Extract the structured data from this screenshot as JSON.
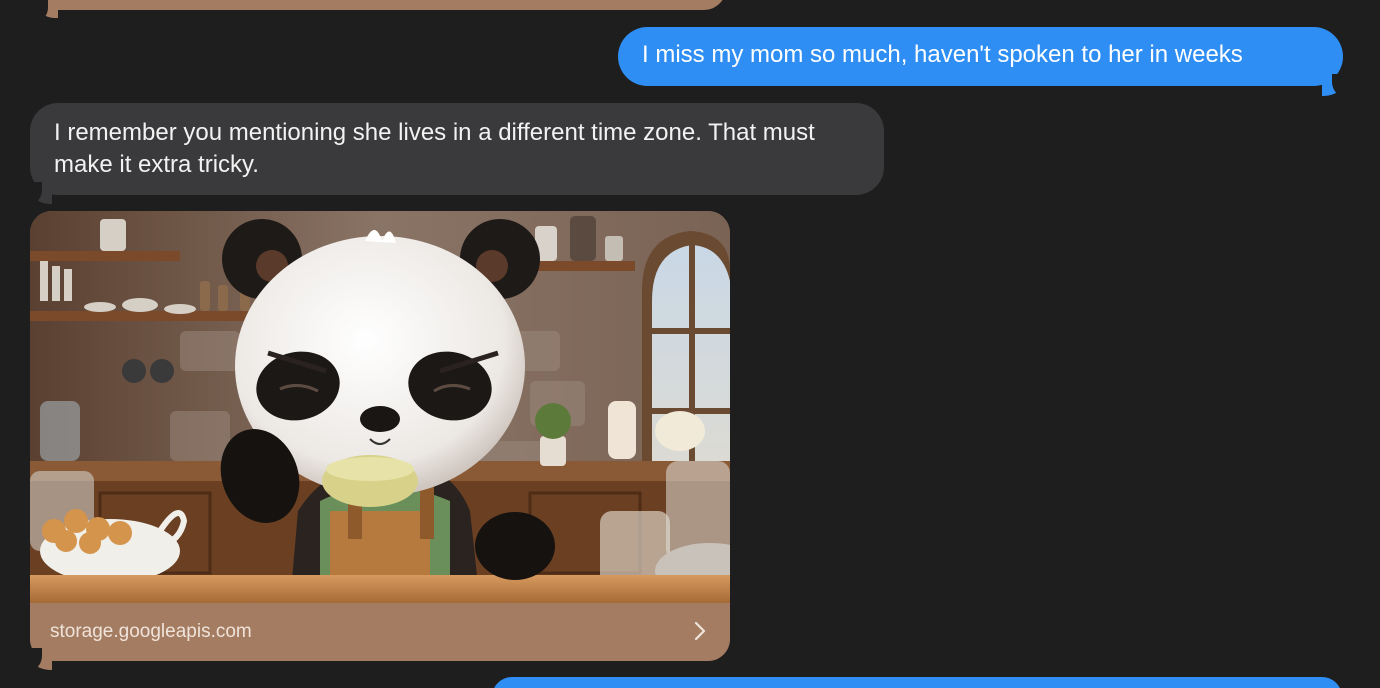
{
  "conversation": {
    "messages": [
      {
        "sender": "me",
        "text": "I miss my mom so much, haven't spoken to her in weeks"
      },
      {
        "sender": "them",
        "text": "I remember you mentioning she lives in a different time zone. That must make it extra tricky."
      }
    ],
    "link_preview": {
      "domain": "storage.googleapis.com",
      "image_icon": "panda-chef-in-kitchen-image",
      "chevron_icon": "chevron-right-icon"
    }
  },
  "colors": {
    "background": "#1e1e1e",
    "sent_bubble": "#2f8ef4",
    "received_bubble": "#3a3a3c",
    "link_footer": "#a47c62"
  }
}
